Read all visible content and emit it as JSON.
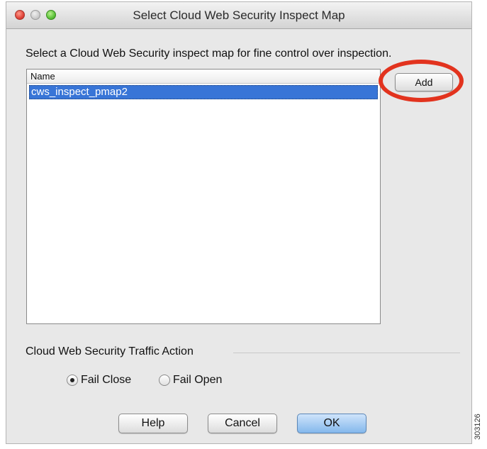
{
  "window": {
    "title": "Select Cloud Web Security Inspect Map"
  },
  "instruction": "Select a Cloud Web Security inspect map for fine control over inspection.",
  "list": {
    "header": "Name",
    "items": [
      {
        "label": "cws_inspect_pmap2",
        "selected": true
      }
    ]
  },
  "buttons": {
    "add": "Add",
    "help": "Help",
    "cancel": "Cancel",
    "ok": "OK"
  },
  "traffic_action": {
    "label": "Cloud Web Security Traffic Action",
    "options": [
      {
        "label": "Fail Close",
        "selected": true
      },
      {
        "label": "Fail Open",
        "selected": false
      }
    ]
  },
  "figure_id": "303126",
  "colors": {
    "selection": "#3875d7",
    "annotation": "#e2331e",
    "ok_button": "#84b8ec"
  }
}
